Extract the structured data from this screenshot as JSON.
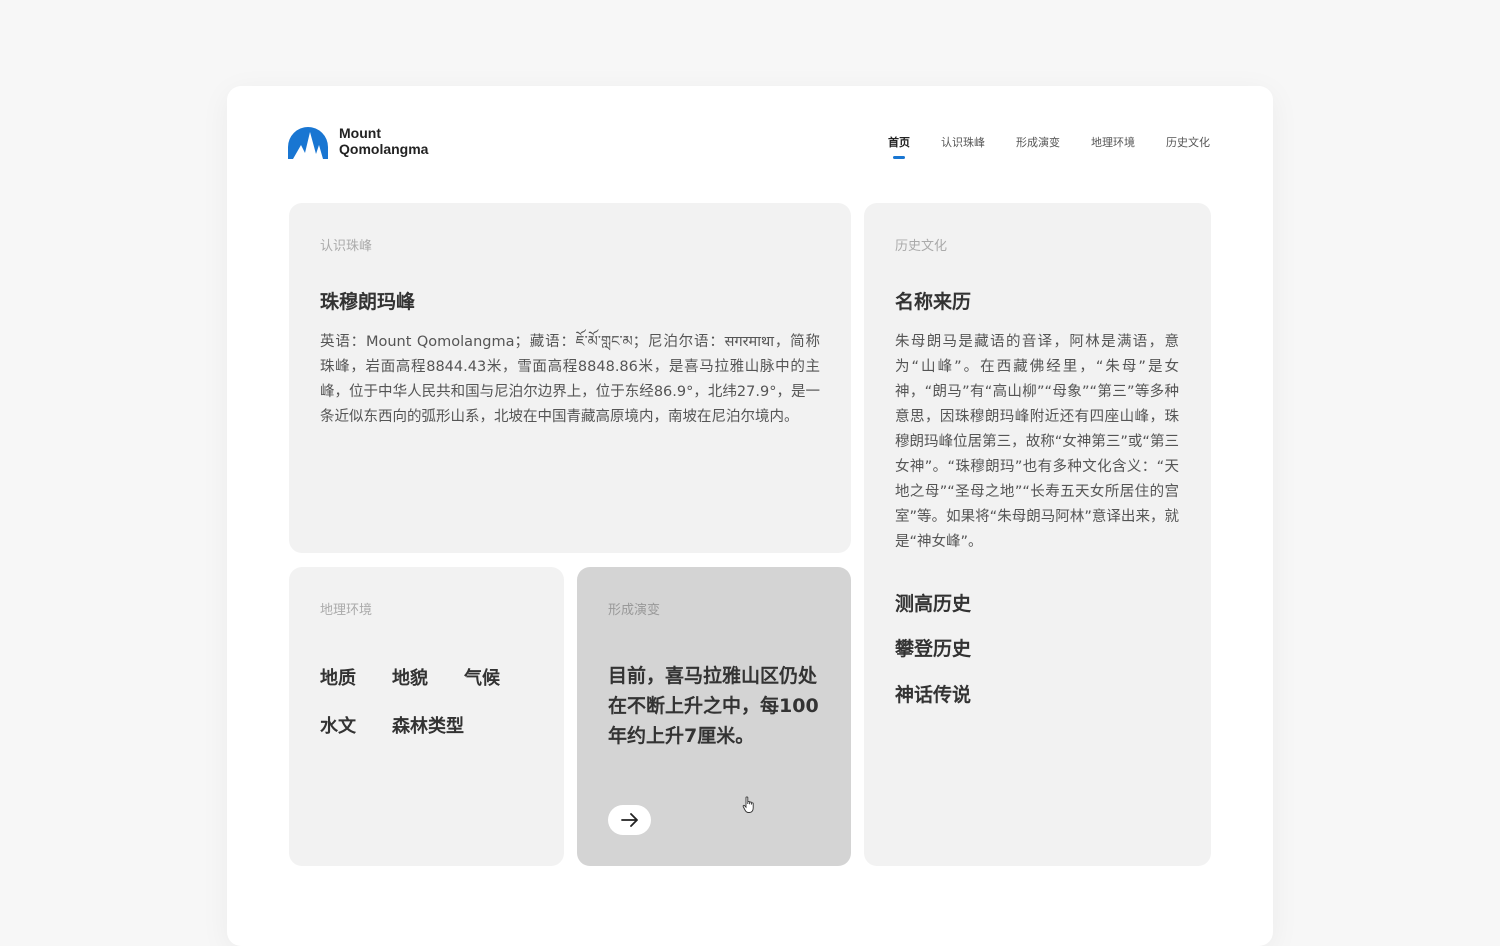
{
  "logo": {
    "line1": "Mount",
    "line2": "Qomolangma",
    "icon": "mountain-logo",
    "color": "#1976d2"
  },
  "nav": {
    "items": [
      {
        "label": "首页",
        "active": true
      },
      {
        "label": "认识珠峰"
      },
      {
        "label": "形成演变"
      },
      {
        "label": "地理环境"
      },
      {
        "label": "历史文化"
      }
    ]
  },
  "recognize": {
    "label": "认识珠峰",
    "title": "珠穆朗玛峰",
    "body": "英语：Mount Qomolangma；藏语：ཇོ་མོ་གླང་མ；尼泊尔语：सगरमाथा，简称珠峰，岩面高程8844.43米，雪面高程8848.86米，是喜马拉雅山脉中的主峰，位于中华人民共和国与尼泊尔边界上，位于东经86.9°，北纬27.9°，是一条近似东西向的弧形山系，北坡在中国青藏高原境内，南坡在尼泊尔境内。"
  },
  "geo": {
    "label": "地理环境",
    "items": [
      "地质",
      "地貌",
      "气候",
      "水文",
      "森林类型"
    ]
  },
  "formation": {
    "label": "形成演变",
    "text": "目前，喜马拉雅山区仍处在不断上升之中，每100年约上升7厘米。",
    "arrow_icon": "arrow-right-icon"
  },
  "history": {
    "label": "历史文化",
    "title": "名称来历",
    "body": "朱母朗马是藏语的音译，阿林是满语，意为“山峰”。在西藏佛经里，“朱母”是女神，“朗马”有“高山柳”“母象”“第三”等多种意思，因珠穆朗玛峰附近还有四座山峰，珠穆朗玛峰位居第三，故称“女神第三”或“第三女神”。“珠穆朗玛”也有多种文化含义：“天地之母”“圣母之地”“长寿五天女所居住的宫室”等。如果将“朱母朗马阿林”意译出来，就是“神女峰”。",
    "links": [
      "测高历史",
      "攀登历史",
      "神话传说"
    ]
  }
}
